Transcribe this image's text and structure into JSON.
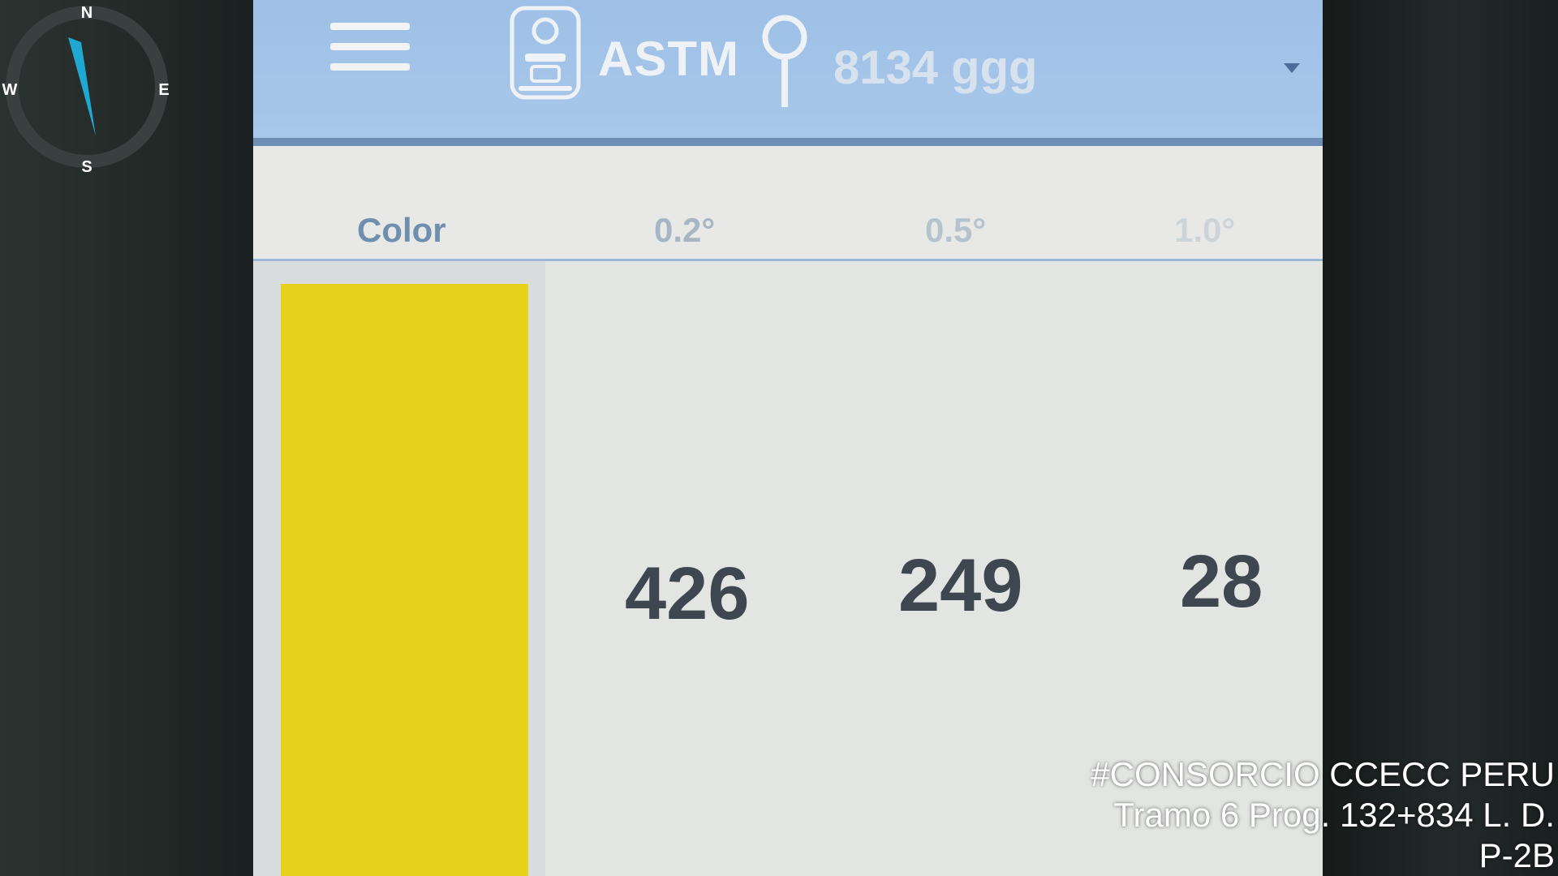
{
  "app_bar": {
    "menu_icon": "hamburger-menu-icon",
    "device_icon": "retroreflectometer-device-icon",
    "standard": "ASTM",
    "location_icon": "map-pin-icon",
    "location": "8134 ggg",
    "dropdown_icon": "chevron-down-icon",
    "color": "#a8c8ea"
  },
  "table": {
    "headers": {
      "color": "Color",
      "angle_02": "0.2°",
      "angle_05": "0.5°",
      "angle_10": "1.0°"
    },
    "row": {
      "swatch_color": "#e6d21a",
      "value_02": "426",
      "value_05": "249",
      "value_10": "28"
    }
  },
  "compass": {
    "north": "N",
    "south": "S",
    "east": "E",
    "west": "W",
    "needle_color": "#1fa8d1"
  },
  "watermark": {
    "line1": "#CONSORCIO CCECC PERU",
    "line2": "Tramo 6 Prog. 132+834 L. D.",
    "line3": "P-2B"
  }
}
